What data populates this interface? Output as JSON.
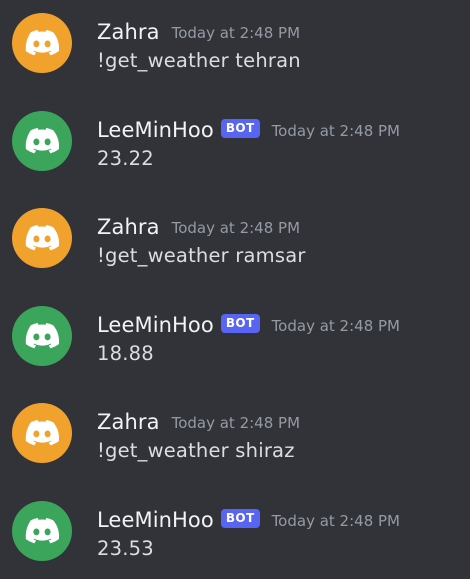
{
  "messages": [
    {
      "author": "Zahra",
      "is_bot": false,
      "avatar_color": "#f0a22c",
      "avatar_icon": "discord-logo-icon",
      "timestamp": "Today at 2:48 PM",
      "content": "!get_weather tehran"
    },
    {
      "author": "LeeMinHoo",
      "is_bot": true,
      "bot_tag": "BOT",
      "avatar_color": "#3ba55c",
      "avatar_icon": "discord-logo-icon",
      "timestamp": "Today at 2:48 PM",
      "content": "23.22"
    },
    {
      "author": "Zahra",
      "is_bot": false,
      "avatar_color": "#f0a22c",
      "avatar_icon": "discord-logo-icon",
      "timestamp": "Today at 2:48 PM",
      "content": "!get_weather ramsar"
    },
    {
      "author": "LeeMinHoo",
      "is_bot": true,
      "bot_tag": "BOT",
      "avatar_color": "#3ba55c",
      "avatar_icon": "discord-logo-icon",
      "timestamp": "Today at 2:48 PM",
      "content": "18.88"
    },
    {
      "author": "Zahra",
      "is_bot": false,
      "avatar_color": "#f0a22c",
      "avatar_icon": "discord-logo-icon",
      "timestamp": "Today at 2:48 PM",
      "content": "!get_weather shiraz"
    },
    {
      "author": "LeeMinHoo",
      "is_bot": true,
      "bot_tag": "BOT",
      "avatar_color": "#3ba55c",
      "avatar_icon": "discord-logo-icon",
      "timestamp": "Today at 2:48 PM",
      "content": "23.53"
    }
  ]
}
